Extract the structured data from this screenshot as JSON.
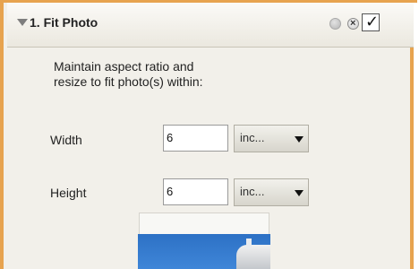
{
  "panel": {
    "title": "1. Fit Photo",
    "accent_color": "#e7a34f",
    "icons": [
      "collapse-arrow-icon",
      "disabled-circle-icon",
      "close-icon",
      "checkmark-icon"
    ],
    "checkbox_checked": true
  },
  "description": {
    "line1": "Maintain aspect ratio and",
    "line2": "resize to fit photo(s) within:"
  },
  "width": {
    "label": "Width",
    "value": "6",
    "unit": "inc..."
  },
  "height": {
    "label": "Height",
    "value": "6",
    "unit": "inc..."
  }
}
